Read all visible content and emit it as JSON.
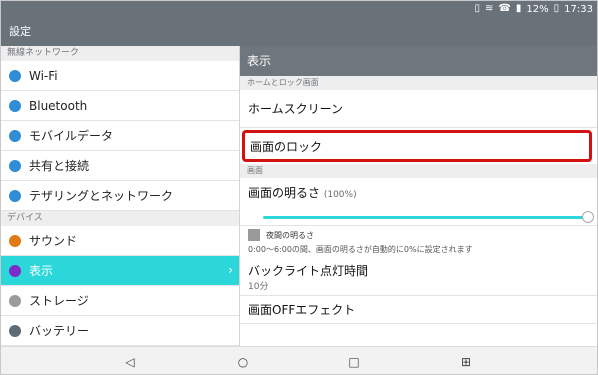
{
  "statusbar": {
    "battery_percent": "12%",
    "time": "17:33",
    "icons": [
      "device-icon",
      "wifi-icon",
      "phone-icon",
      "signal-icon"
    ]
  },
  "app": {
    "title": "設定"
  },
  "left_pane": {
    "sections": [
      {
        "header": "無線ネットワーク",
        "items": [
          {
            "label": "Wi-Fi",
            "icon": "wifi-icon",
            "color": "#2f8dd6"
          },
          {
            "label": "Bluetooth",
            "icon": "bluetooth-icon",
            "color": "#2f8dd6"
          },
          {
            "label": "モバイルデータ",
            "icon": "mobile-data-icon",
            "color": "#2f8dd6"
          },
          {
            "label": "共有と接続",
            "icon": "share-icon",
            "color": "#2f8dd6"
          },
          {
            "label": "テザリングとネットワーク",
            "icon": "tethering-icon",
            "color": "#2f8dd6"
          }
        ]
      },
      {
        "header": "デバイス",
        "items": [
          {
            "label": "サウンド",
            "icon": "sound-icon",
            "color": "#e07a14"
          },
          {
            "label": "表示",
            "icon": "display-icon",
            "color": "#7b2cc9",
            "active": true
          },
          {
            "label": "ストレージ",
            "icon": "storage-icon",
            "color": "#9a9a9a"
          },
          {
            "label": "バッテリー",
            "icon": "battery-icon",
            "color": "#5f6b74"
          }
        ]
      }
    ]
  },
  "right_pane": {
    "title": "表示",
    "section_lock_header": "ホームとロック画面",
    "home_screen_label": "ホームスクリーン",
    "lock_label": "画面のロック",
    "section_screen_header": "画面",
    "brightness_label": "画面の明るさ",
    "brightness_value": "(100%)",
    "brightness_level": 1,
    "night_label": "夜間の明るさ",
    "night_note": "0:00～6:00の間、画面の明るさが自動的に0%に設定されます",
    "backlight_label": "バックライト点灯時間",
    "backlight_value": "10分",
    "screen_off_label": "画面OFFエフェクト",
    "accent_color": "#2cd7d9",
    "highlight_color": "#d41111"
  }
}
